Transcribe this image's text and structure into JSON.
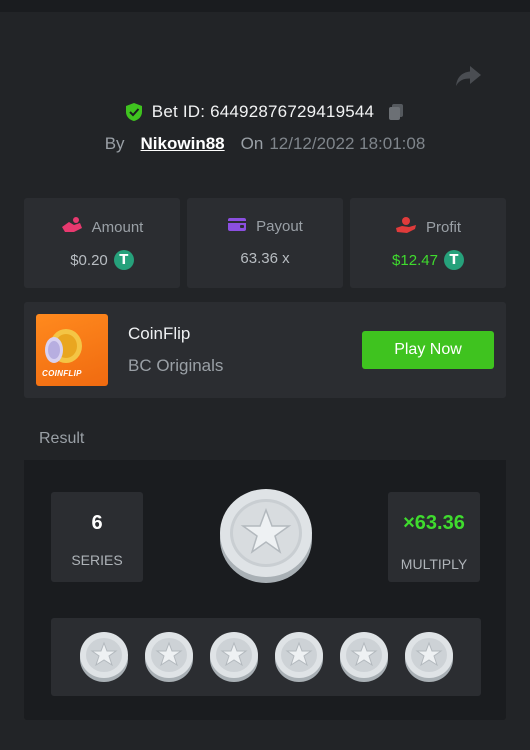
{
  "bet": {
    "label": "Bet ID: ",
    "id": "64492876729419544",
    "by_label": "By",
    "user": "Nikowin88",
    "on_label": "On",
    "date": "12/12/2022 18:01:08"
  },
  "stats": {
    "amount": {
      "label": "Amount",
      "value": "$0.20",
      "icon": "tether-coin-icon"
    },
    "payout": {
      "label": "Payout",
      "value": "63.36 x"
    },
    "profit": {
      "label": "Profit",
      "value": "$12.47",
      "icon": "tether-coin-icon"
    }
  },
  "game": {
    "thumb_label": "COINFLIP",
    "name": "CoinFlip",
    "provider": "BC Originals",
    "play_label": "Play Now"
  },
  "result": {
    "label": "Result",
    "series_value": "6",
    "series_label": "SERIES",
    "multiply_value": "×63.36",
    "multiply_label": "MULTIPLY",
    "coins": [
      "silver-star",
      "silver-star",
      "silver-star",
      "silver-star",
      "silver-star",
      "silver-star"
    ]
  },
  "colors": {
    "accent_green": "#3fc31f",
    "profit_green": "#3fdb2e",
    "tether": "#26a17b",
    "amount_icon": "#e8396f",
    "payout_icon": "#8b4fe0",
    "profit_icon": "#e03b3b"
  }
}
